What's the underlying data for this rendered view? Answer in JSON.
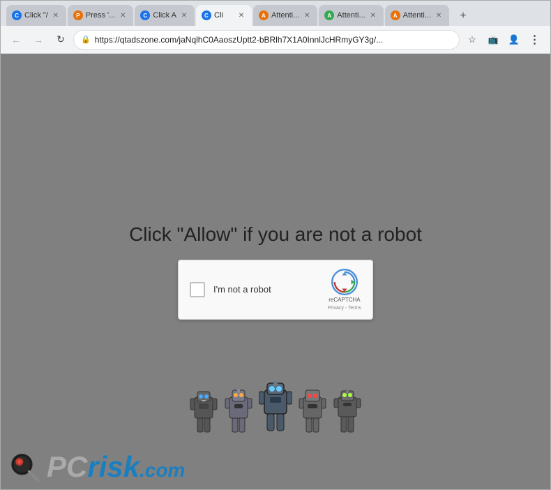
{
  "browser": {
    "title": "Click",
    "window_controls": {
      "minimize": "─",
      "maximize": "□",
      "close": "✕"
    }
  },
  "tabs": [
    {
      "id": "tab1",
      "label": "Click \"/",
      "favicon_color": "#1a73e8",
      "favicon_letter": "C",
      "active": false
    },
    {
      "id": "tab2",
      "label": "Press '...",
      "favicon_color": "#e8710a",
      "favicon_letter": "P",
      "active": false
    },
    {
      "id": "tab3",
      "label": "Click A",
      "favicon_color": "#1a73e8",
      "favicon_letter": "C",
      "active": false
    },
    {
      "id": "tab4",
      "label": "Cli",
      "favicon_color": "#1a73e8",
      "favicon_letter": "C",
      "active": true
    },
    {
      "id": "tab5",
      "label": "Attenti...",
      "favicon_color": "#e8710a",
      "favicon_letter": "A",
      "active": false
    },
    {
      "id": "tab6",
      "label": "Attenti...",
      "favicon_color": "#34a853",
      "favicon_letter": "A",
      "active": false
    },
    {
      "id": "tab7",
      "label": "Attenti...",
      "favicon_color": "#e8710a",
      "favicon_letter": "A",
      "active": false
    }
  ],
  "address_bar": {
    "url": "https://qtadszone.com/jaNqlhC0AaoszUptt2-bBRlh7X1A0InnlJcHRmyGY3g/...",
    "lock_icon": "🔒"
  },
  "page": {
    "background_color": "#808080",
    "main_text": "Click \"Allow\"   if you are not   a robot",
    "recaptcha": {
      "checkbox_label": "I'm not a robot",
      "brand": "reCAPTCHA",
      "privacy_text": "Privacy - Terms"
    },
    "watermark": {
      "pc_text": "PC",
      "risk_text": "risk",
      "com_text": ".com"
    }
  }
}
